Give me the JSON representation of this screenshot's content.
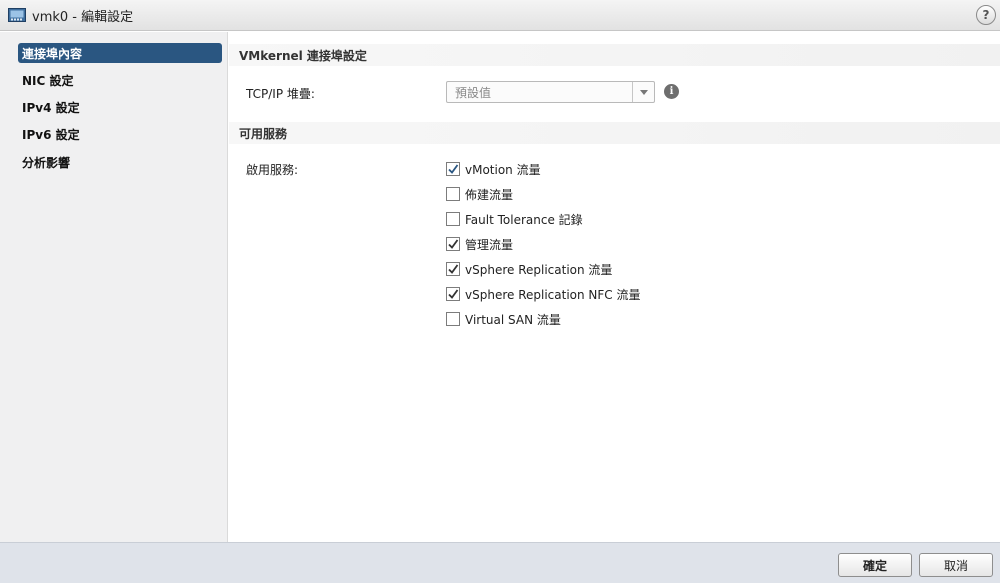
{
  "window": {
    "title": "vmk0 - 編輯設定",
    "help_glyph": "?"
  },
  "sidebar": {
    "items": [
      {
        "label": "連接埠內容",
        "active": true
      },
      {
        "label": "NIC 設定",
        "active": false
      },
      {
        "label": "IPv4 設定",
        "active": false
      },
      {
        "label": "IPv6 設定",
        "active": false
      },
      {
        "label": "分析影響",
        "active": false
      }
    ]
  },
  "main": {
    "section_vmkernel": "VMkernel 連接埠設定",
    "tcpip_label": "TCP/IP 堆疊:",
    "tcpip_value": "預設值",
    "section_services": "可用服務",
    "services_label": "啟用服務:",
    "services": [
      {
        "label": "vMotion 流量",
        "checked": true
      },
      {
        "label": "佈建流量",
        "checked": false
      },
      {
        "label": "Fault Tolerance 記錄",
        "checked": false
      },
      {
        "label": "管理流量",
        "checked": true
      },
      {
        "label": "vSphere Replication 流量",
        "checked": true
      },
      {
        "label": "vSphere Replication NFC 流量",
        "checked": true
      },
      {
        "label": "Virtual SAN 流量",
        "checked": false
      }
    ]
  },
  "footer": {
    "ok_label": "確定",
    "cancel_label": "取消"
  },
  "icons": {
    "window": "network-adapter-icon",
    "help": "help-icon",
    "info": "info-icon",
    "dropdown": "chevron-down-icon",
    "checkmark": "checkmark-icon"
  },
  "colors": {
    "accent": "#2a5681",
    "footer": "#dfe3ea",
    "sidebar": "#f0f0f1"
  }
}
